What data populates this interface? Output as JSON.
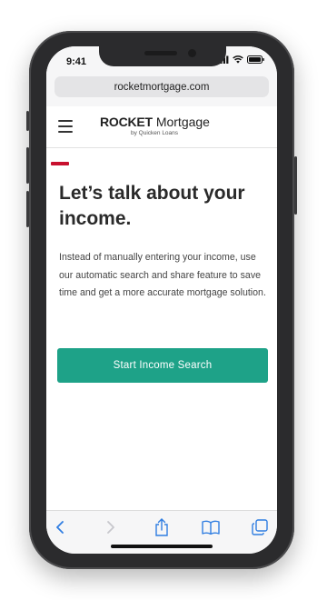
{
  "status_bar": {
    "time": "9:41",
    "icons": [
      "signal-icon",
      "wifi-icon",
      "battery-icon"
    ]
  },
  "browser": {
    "url": "rocketmortgage.com",
    "toolbar_icons": [
      "back-icon",
      "forward-icon",
      "share-icon",
      "bookmarks-icon",
      "tabs-icon"
    ]
  },
  "header": {
    "menu_icon": "hamburger-menu-icon",
    "logo": {
      "brand_part1": "ROCKET",
      "brand_part2": "Mortgage",
      "tagline": "by Quicken Loans"
    }
  },
  "main": {
    "headline": "Let’s talk about your income.",
    "body": "Instead of manually entering your income, use our automatic search and share feature to save time and get a more accurate mortgage solution.",
    "cta_label": "Start Income Search"
  },
  "colors": {
    "brand_red": "#c8102e",
    "cta_green": "#1ea288",
    "ios_blue": "#2f7de1"
  }
}
